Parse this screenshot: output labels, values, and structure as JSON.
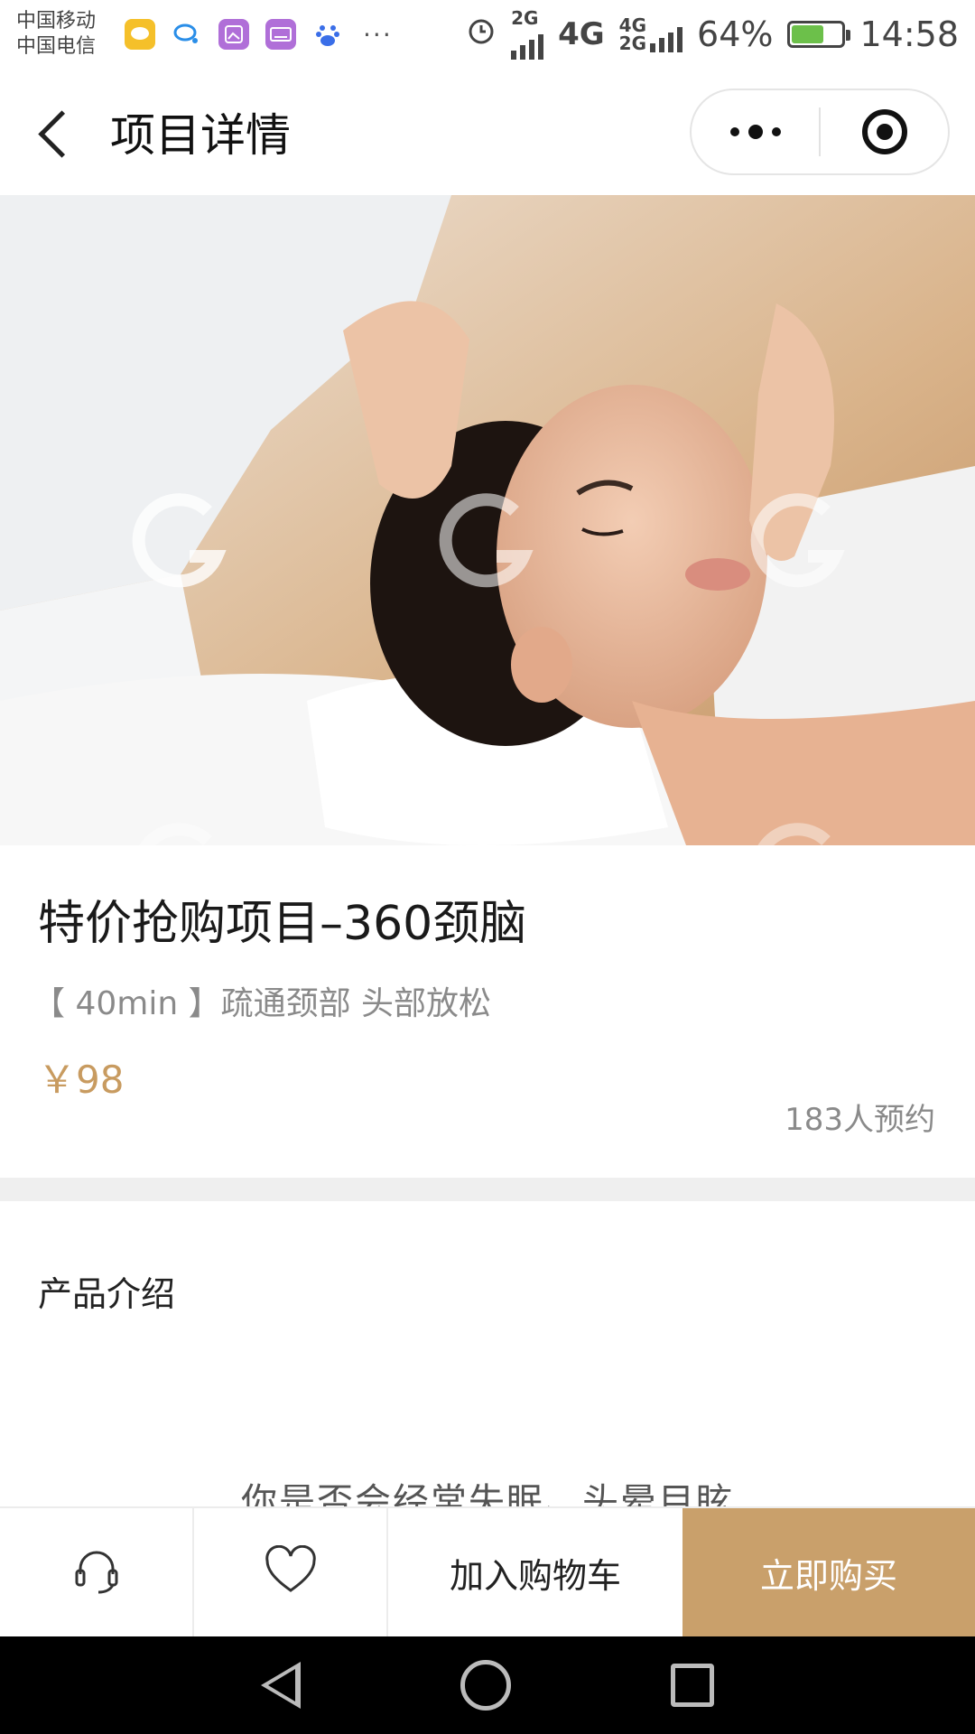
{
  "status_bar": {
    "carrier_1": "中国移动",
    "carrier_2": "中国电信",
    "signal_1_label": "2G",
    "signal_2_label": "4G",
    "signal_3_label_top": "4G",
    "signal_3_label_bottom": "2G",
    "battery_percent_text": "64%",
    "battery_level": 0.64,
    "time": "14:58",
    "more_glyph": "···"
  },
  "nav": {
    "title": "项目详情"
  },
  "product": {
    "title": "特价抢购项目–360颈脑",
    "subtitle": "【 40min 】疏通颈部 头部放松",
    "price": "￥98",
    "bookings": "183人预约"
  },
  "intro": {
    "heading": "产品介绍",
    "first_line": "你是否会经常失眠、头晕目眩"
  },
  "action_bar": {
    "add_to_cart": "加入购物车",
    "buy_now": "立即购买"
  },
  "colors": {
    "accent_gold": "#c9a06b",
    "price_color": "#c89b60"
  }
}
